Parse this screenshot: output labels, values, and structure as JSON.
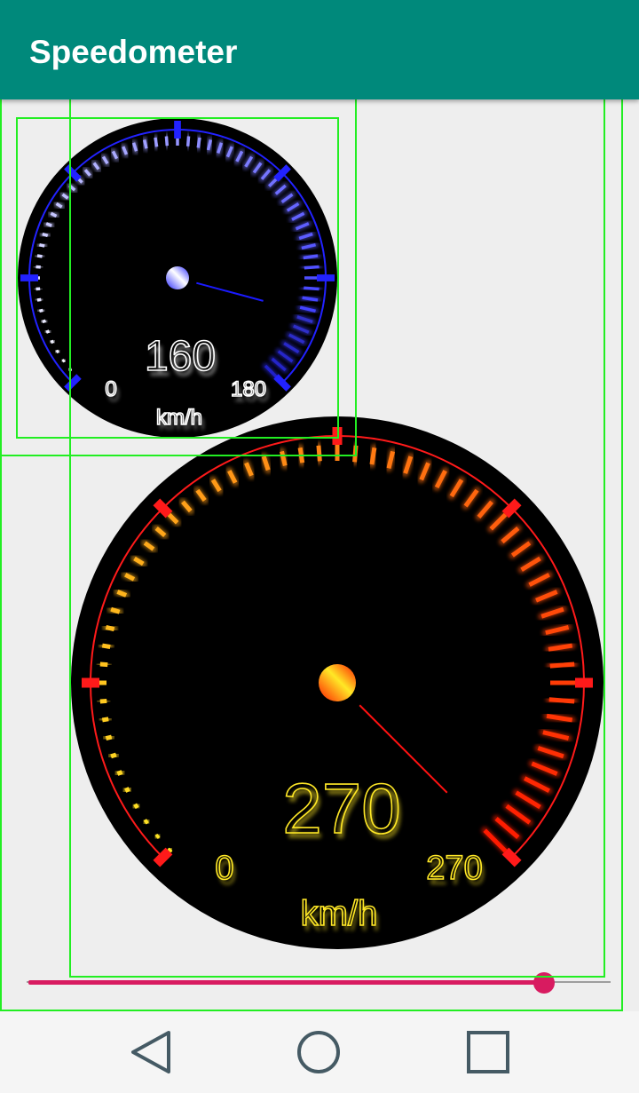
{
  "app": {
    "title": "Speedometer"
  },
  "colors": {
    "app_bar": "#00897b",
    "slider_accent": "#d81b60",
    "layout_bounds": "#22ee22",
    "small_gauge_accent": "#2222ff",
    "large_gauge_accent": "#ff1a1a",
    "large_gauge_text": "#ffe826"
  },
  "gauges": [
    {
      "id": "small",
      "value": 160,
      "value_label": "160",
      "min": 0,
      "max": 180,
      "min_label": "0",
      "max_label": "180",
      "unit": "km/h",
      "tick_colors": [
        "#ffffff",
        "#2a2aff"
      ],
      "ring_color": "#2222ff",
      "needle_color": "#1a1aff",
      "text_color": "#ffffff"
    },
    {
      "id": "large",
      "value": 270,
      "value_label": "270",
      "min": 0,
      "max": 270,
      "min_label": "0",
      "max_label": "270",
      "unit": "km/h",
      "tick_colors": [
        "#ffe826",
        "#ff1a00"
      ],
      "ring_color": "#ff1a1a",
      "needle_color": "#ff1111",
      "text_color": "#ffe826"
    }
  ],
  "slider": {
    "value_fraction": 0.885
  },
  "navbar": {
    "icons": [
      "back-triangle-icon",
      "home-circle-icon",
      "recents-square-icon"
    ]
  }
}
